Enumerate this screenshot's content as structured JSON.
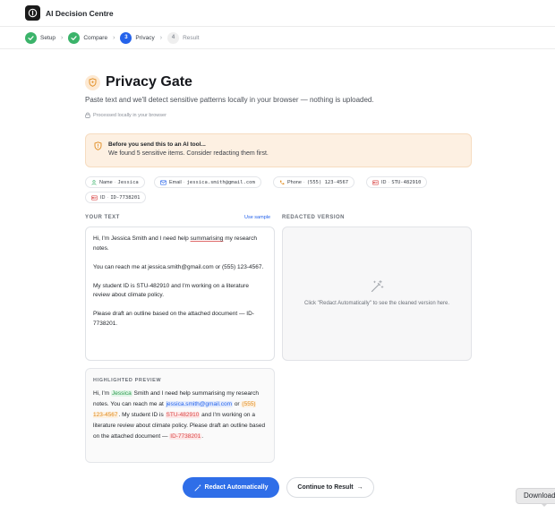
{
  "app": {
    "title": "AI Decision Centre"
  },
  "stepper": {
    "steps": [
      {
        "num": "",
        "label": "Setup",
        "state": "done"
      },
      {
        "num": "",
        "label": "Compare",
        "state": "done"
      },
      {
        "num": "3",
        "label": "Privacy",
        "state": "active"
      },
      {
        "num": "4",
        "label": "Result",
        "state": "todo"
      }
    ]
  },
  "page": {
    "title": "Privacy Gate",
    "subtitle": "Paste text and we'll detect sensitive patterns locally in your browser — nothing is uploaded.",
    "local_note": "Processed locally in your browser"
  },
  "alert": {
    "title": "Before you send this to an AI tool...",
    "body": "We found 5 sensitive items. Consider redacting them first."
  },
  "chips": [
    {
      "icon": "person-icon",
      "label": "Name",
      "value": "Jessica"
    },
    {
      "icon": "mail-icon",
      "label": "Email",
      "value": "jessica.smith@gmail.com"
    },
    {
      "icon": "phone-icon",
      "label": "Phone",
      "value": "(555) 123-4567"
    },
    {
      "icon": "id-card-icon",
      "label": "ID",
      "value": "STU-482910"
    },
    {
      "icon": "id-card-icon",
      "label": "ID",
      "value": "ID-7738201"
    }
  ],
  "editor": {
    "heading": "YOUR TEXT",
    "use_sample": "Use sample",
    "p1_a": "Hi, I'm Jessica Smith and I need help ",
    "p1_u": "summarising",
    "p1_b": " my research notes.",
    "p2": "You can reach me at jessica.smith@gmail.com or (555) 123-4567.",
    "p3": "My student ID is STU-482910 and I'm working on a literature review about climate policy.",
    "p4": "Please draft an outline based on the attached document — ID-7738201."
  },
  "redacted": {
    "heading": "REDACTED VERSION",
    "placeholder": "Click \"Redact Automatically\" to see the cleaned version here."
  },
  "preview": {
    "heading": "HIGHLIGHTED PREVIEW",
    "t1": "Hi, I'm ",
    "name": "Jessica",
    "t2": " Smith and I need help summarising my research notes. You can reach me at ",
    "email": "jessica.smith@gmail.com",
    "t3": " or ",
    "phone": "(555) 123-4567",
    "t4": ". My student ID is ",
    "id1": "STU-482910",
    "t5": " and I'm working on a literature review about climate policy. Please draft an outline based on the attached document — ",
    "id2": "ID-7738201",
    "t6": "."
  },
  "actions": {
    "redact_label": "Redact Automatically",
    "continue_label": "Continue to Result",
    "continue_arrow": "→"
  },
  "download": {
    "label": "Download"
  },
  "colors": {
    "accent": "#2f6ee8",
    "done": "#3bb36a",
    "name": "#2b9a4f",
    "email": "#2563eb",
    "phone": "#e08a1c",
    "id": "#d94848"
  }
}
